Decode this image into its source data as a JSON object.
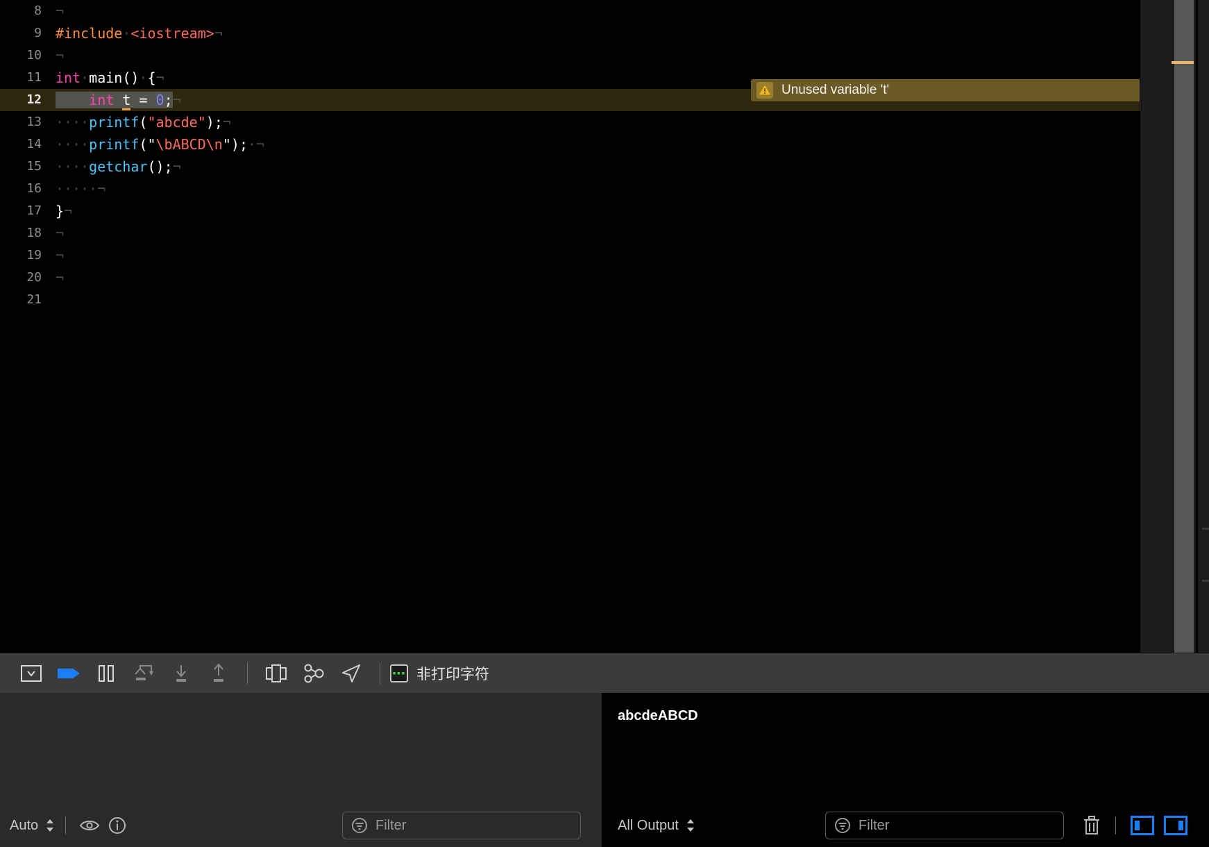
{
  "editor": {
    "language": "cpp",
    "first_line": 8,
    "lines": [
      {
        "num": "8",
        "tokens": [
          {
            "t": "¬",
            "c": "inv"
          }
        ]
      },
      {
        "num": "9",
        "tokens": [
          {
            "t": "#include",
            "c": "pre"
          },
          {
            "t": "·",
            "c": "dot"
          },
          {
            "t": "<iostream>",
            "c": "hdr"
          },
          {
            "t": "¬",
            "c": "inv"
          }
        ]
      },
      {
        "num": "10",
        "tokens": [
          {
            "t": "¬",
            "c": "inv"
          }
        ]
      },
      {
        "num": "11",
        "tokens": [
          {
            "t": "int",
            "c": "kw"
          },
          {
            "t": "·",
            "c": "dot"
          },
          {
            "t": "main()",
            "c": "plain"
          },
          {
            "t": "·",
            "c": "dot"
          },
          {
            "t": "{",
            "c": "plain"
          },
          {
            "t": "¬",
            "c": "inv"
          }
        ]
      },
      {
        "num": "12",
        "highlight": true,
        "selection": true,
        "tokens": [
          {
            "t": "····",
            "c": "dot"
          },
          {
            "t": "int",
            "c": "kw"
          },
          {
            "t": "·",
            "c": "dot"
          },
          {
            "t": "t",
            "c": "plain",
            "underline": true
          },
          {
            "t": "·",
            "c": "dot"
          },
          {
            "t": "=",
            "c": "plain"
          },
          {
            "t": "·",
            "c": "dot"
          },
          {
            "t": "0",
            "c": "num"
          },
          {
            "t": ";",
            "c": "plain"
          }
        ],
        "after": [
          {
            "t": "¬",
            "c": "inv"
          }
        ]
      },
      {
        "num": "13",
        "tokens": [
          {
            "t": "····",
            "c": "dot"
          },
          {
            "t": "printf",
            "c": "fn"
          },
          {
            "t": "(",
            "c": "plain"
          },
          {
            "t": "\"abcde\"",
            "c": "str"
          },
          {
            "t": ")",
            "c": "plain"
          },
          {
            "t": ";",
            "c": "plain"
          },
          {
            "t": "¬",
            "c": "inv"
          }
        ]
      },
      {
        "num": "14",
        "tokens": [
          {
            "t": "····",
            "c": "dot"
          },
          {
            "t": "printf",
            "c": "fn"
          },
          {
            "t": "(",
            "c": "plain"
          },
          {
            "t": "\"",
            "c": "plain"
          },
          {
            "t": "\\bABCD\\n",
            "c": "str"
          },
          {
            "t": "\"",
            "c": "plain"
          },
          {
            "t": ")",
            "c": "plain"
          },
          {
            "t": ";",
            "c": "plain"
          },
          {
            "t": "·",
            "c": "dot"
          },
          {
            "t": "¬",
            "c": "inv"
          }
        ]
      },
      {
        "num": "15",
        "tokens": [
          {
            "t": "····",
            "c": "dot"
          },
          {
            "t": "getchar",
            "c": "fn"
          },
          {
            "t": "()",
            "c": "plain"
          },
          {
            "t": ";",
            "c": "plain"
          },
          {
            "t": "¬",
            "c": "inv"
          }
        ]
      },
      {
        "num": "16",
        "tokens": [
          {
            "t": "····",
            "c": "dot"
          },
          {
            "t": "·",
            "c": "dot"
          },
          {
            "t": "¬",
            "c": "inv"
          }
        ]
      },
      {
        "num": "17",
        "tokens": [
          {
            "t": "}",
            "c": "plain"
          },
          {
            "t": "¬",
            "c": "inv"
          }
        ]
      },
      {
        "num": "18",
        "tokens": [
          {
            "t": "¬",
            "c": "inv"
          }
        ]
      },
      {
        "num": "19",
        "tokens": [
          {
            "t": "¬",
            "c": "inv"
          }
        ]
      },
      {
        "num": "20",
        "tokens": [
          {
            "t": "¬",
            "c": "inv"
          }
        ]
      },
      {
        "num": "21",
        "tokens": []
      }
    ],
    "warning": {
      "text": "Unused variable 't'",
      "icon": "warning-triangle-icon",
      "background": "#6b5a24",
      "line": 12
    },
    "minimap": {
      "marker_color": "#e8b96a"
    }
  },
  "debug_bar": {
    "buttons": [
      {
        "name": "hide-debug-area-button",
        "icon": "panel-collapse-icon",
        "active": false
      },
      {
        "name": "continue-button",
        "icon": "continue-arrow-icon",
        "active": true,
        "color": "#1a7ef5"
      },
      {
        "name": "pause-button",
        "icon": "pause-icon",
        "active": false
      },
      {
        "name": "step-over-button",
        "icon": "step-over-icon",
        "disabled": true
      },
      {
        "name": "step-into-button",
        "icon": "step-into-icon",
        "disabled": true
      },
      {
        "name": "step-out-button",
        "icon": "step-out-icon",
        "disabled": true
      },
      {
        "name": "view-debugger-button",
        "icon": "view-hierarchy-icon",
        "disabled": false
      },
      {
        "name": "memory-graph-button",
        "icon": "memory-graph-icon",
        "disabled": false
      },
      {
        "name": "simulate-location-button",
        "icon": "location-arrow-icon",
        "disabled": false
      }
    ],
    "npc_label": "非打印字符",
    "npc_icon": "terminal-icon"
  },
  "variables_panel": {
    "scope_label": "Auto",
    "eye_icon": "eye-icon",
    "info_icon": "info-circle-icon",
    "filter_placeholder": "Filter",
    "filter_value": "",
    "filter_icon": "filter-circle-icon",
    "rows": []
  },
  "console_panel": {
    "output_scope_label": "All Output",
    "filter_placeholder": "Filter",
    "filter_value": "",
    "filter_icon": "filter-circle-icon",
    "output_lines": [
      "abcdeABCD"
    ],
    "trash_icon": "trash-icon",
    "split_left_icon": "show-variables-pane-icon",
    "split_right_icon": "show-console-pane-icon",
    "toggle_color": "#1a7ef5"
  }
}
